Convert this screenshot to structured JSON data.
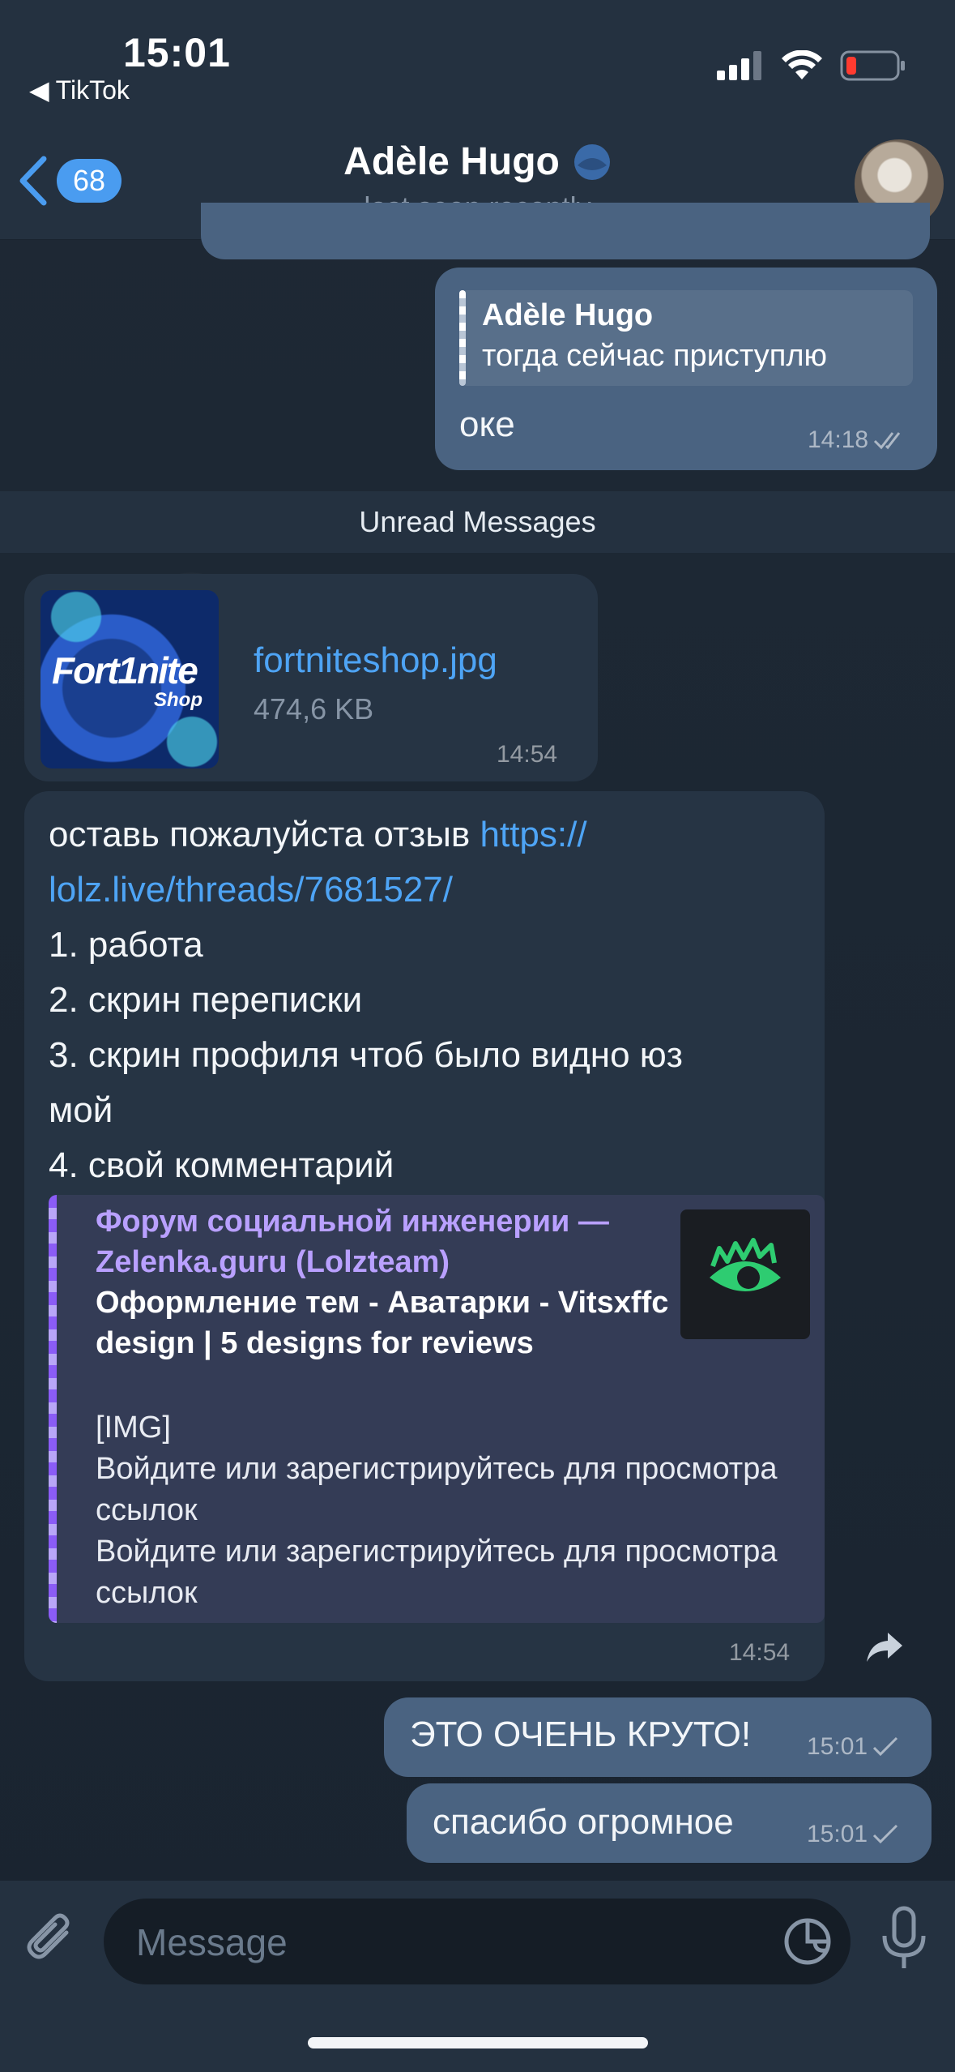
{
  "status_bar": {
    "time": "15:01",
    "back_app": "TikTok"
  },
  "header": {
    "back_count": "68",
    "contact_name": "Adèle Hugo",
    "status": "last seen recently"
  },
  "messages": {
    "reply_message": {
      "quoted_name": "Adèle Hugo",
      "quoted_text": "тогда сейчас приступлю",
      "text": "оке",
      "time": "14:18"
    },
    "unread_label": "Unread Messages",
    "file_message": {
      "thumb_label_1": "Fort1nite",
      "thumb_label_2": "Shop",
      "file_name": "fortniteshop.jpg",
      "file_size": "474,6 KB",
      "time": "14:54"
    },
    "review_message": {
      "text_before_link": "оставь пожалуйста отзыв ",
      "link_part1": "https://",
      "link_part2": "lolz.live/threads/7681527/",
      "line1": "1. работа",
      "line2": "2. скрин переписки",
      "line3": "3. скрин профиля чтоб было видно юз",
      "line3b": "мой",
      "line4": "4. свой комментарий",
      "preview": {
        "site_name": "Форум социальной инженерии —  Zelenka.guru (Lolzteam)",
        "title": "Оформление тем - Аватарки - Vitsxffc design | 5 designs for reviews",
        "description": "[IMG]\nВойдите или зарегистрируйтесь для просмотра ссылок\nВойдите или зарегистрируйтесь для просмотра ссылок"
      },
      "time": "14:54"
    },
    "outgoing_1": {
      "text": "ЭТО ОЧЕНЬ КРУТО!",
      "time": "15:01"
    },
    "outgoing_2": {
      "text": "спасибо огромное",
      "time": "15:01"
    }
  },
  "composer": {
    "placeholder": "Message"
  },
  "colors": {
    "accent": "#4a9cf0",
    "outgoing_bubble": "#4a6381",
    "incoming_bubble": "#263444",
    "preview_accent": "#8b5cf6"
  }
}
